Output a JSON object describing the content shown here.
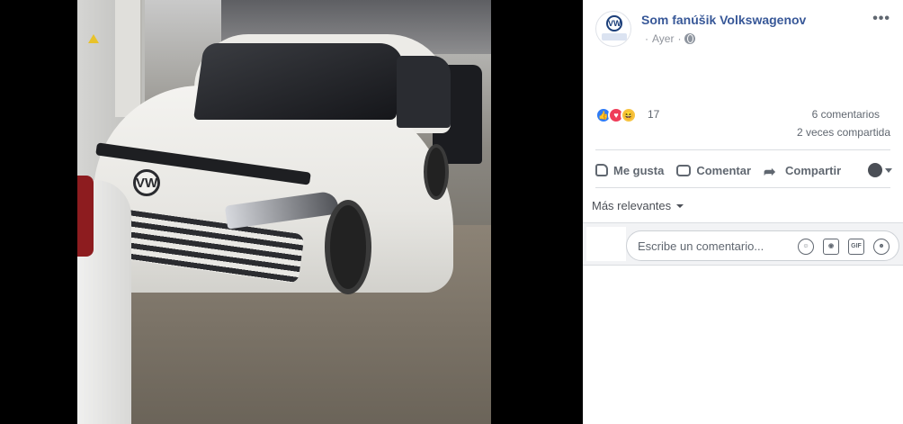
{
  "photo": {
    "logo_text": "VW"
  },
  "post": {
    "page_name": "Som fanúšik Volkswagenov",
    "timestamp": "Ayer",
    "separator": "·",
    "more": "•••"
  },
  "stats": {
    "reaction_count": "17",
    "comments": "6 comentarios",
    "shares": "2 veces compartida"
  },
  "actions": {
    "like": "Me gusta",
    "comment": "Comentar",
    "share": "Compartir"
  },
  "sort": {
    "label": "Más relevantes"
  },
  "comment_box": {
    "placeholder": "Escribe un comentario...",
    "gif_label": "GIF"
  },
  "colors": {
    "page_name": "#385898",
    "like": "#2e7bf6",
    "love": "#ef3c59",
    "haha": "#f7c33f"
  }
}
